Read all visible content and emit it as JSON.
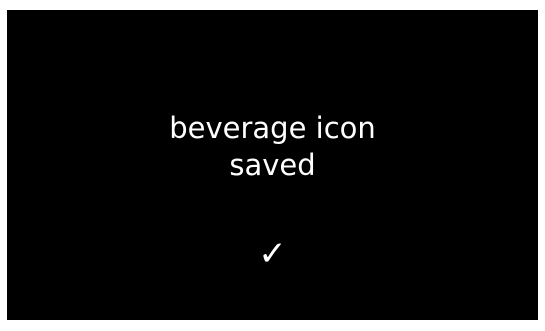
{
  "confirmation": {
    "line1": "beverage icon",
    "line2": "saved",
    "checkmark_glyph": "✓",
    "icon": "checkmark-icon"
  },
  "colors": {
    "screen_background": "#000000",
    "text": "#ffffff",
    "outer_background": "#ffffff"
  }
}
